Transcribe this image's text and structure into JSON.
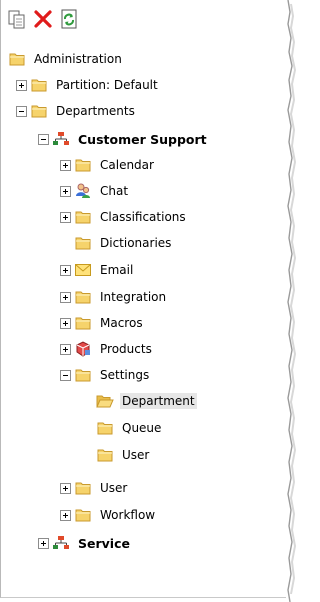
{
  "toolbar": {
    "icons": [
      "copy-icon",
      "delete-icon",
      "refresh-icon"
    ]
  },
  "tree": {
    "root": "Administration",
    "partition": "Partition: Default",
    "departments": "Departments",
    "customer_support": "Customer Support",
    "calendar": "Calendar",
    "chat": "Chat",
    "classifications": "Classifications",
    "dictionaries": "Dictionaries",
    "email": "Email",
    "integration": "Integration",
    "macros": "Macros",
    "products": "Products",
    "settings": "Settings",
    "settings_department": "Department",
    "settings_queue": "Queue",
    "settings_user": "User",
    "user": "User",
    "workflow": "Workflow",
    "service": "Service"
  },
  "colors": {
    "folder": "#f6d36b",
    "folder_edge": "#c99a2e",
    "delete": "#e01b1b",
    "refresh": "#2f9a3c",
    "selection": "#e6e6e6"
  }
}
